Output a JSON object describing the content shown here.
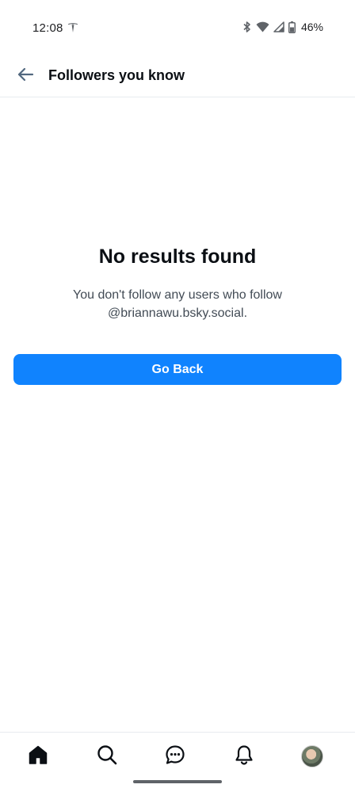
{
  "status_bar": {
    "time": "12:08",
    "battery": "46%",
    "icons": [
      "tesla-icon",
      "bluetooth-icon",
      "wifi-icon",
      "signal-icon",
      "battery-icon"
    ]
  },
  "header": {
    "title": "Followers you know",
    "back_icon": "arrow-left-icon"
  },
  "empty_state": {
    "title": "No results found",
    "message": "You don't follow any users who follow @briannawu.bsky.social.",
    "button_label": "Go Back"
  },
  "bottom_nav": {
    "items": [
      "home-icon",
      "search-icon",
      "chat-icon",
      "bell-icon",
      "avatar"
    ]
  },
  "colors": {
    "accent": "#1083fe",
    "text_primary": "#0b0f14",
    "text_secondary": "#424b55",
    "divider": "#e8ebef"
  }
}
